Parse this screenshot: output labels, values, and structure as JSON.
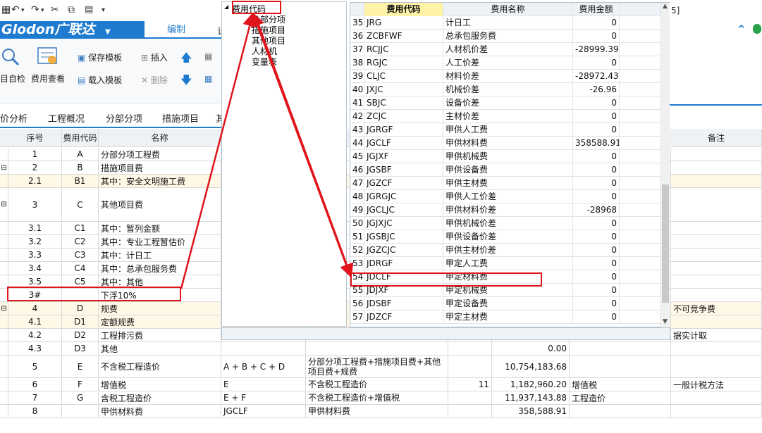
{
  "toolbar": {
    "undo": "↶",
    "redo": "↷",
    "cut": "✂",
    "copy": "⧉",
    "paste": "📋",
    "more": "▾"
  },
  "brand": {
    "name": "Glodon广联达",
    "arrow": "▼"
  },
  "tabs": {
    "edit": "编制",
    "partial": "计"
  },
  "ribbon": {
    "check": "目自检",
    "fee_view": "费用查看",
    "save_template": "保存模板",
    "load_template": "载入模板",
    "insert": "插入",
    "delete": "删除"
  },
  "nav": [
    "价分析",
    "工程概况",
    "分部分项",
    "措施项目",
    "其"
  ],
  "right": {
    "title_fragment": "5]",
    "collapse": "^",
    "remark_header": "备注"
  },
  "grid": {
    "headers": {
      "seq": "序号",
      "code": "费用代码",
      "name": "名称"
    },
    "rows": [
      {
        "seq": "1",
        "code": "A",
        "name": "分部分项工程费",
        "expr": "",
        "base": "",
        "rate": "",
        "amount": "",
        "type": "",
        "remark": "",
        "tree": "",
        "y": false
      },
      {
        "seq": "2",
        "code": "B",
        "name": "措施项目费",
        "expr": "",
        "base": "",
        "rate": "",
        "amount": "",
        "type": "",
        "remark": "",
        "tree": "⊟",
        "y": false
      },
      {
        "seq": "2.1",
        "code": "B1",
        "name": "其中：安全文明施工费",
        "expr": "",
        "base": "",
        "rate": "",
        "amount": "",
        "type": "",
        "remark": "",
        "tree": "",
        "y": true
      },
      {
        "seq": "3",
        "code": "C",
        "name": "其他项目费",
        "expr": "",
        "base": "",
        "rate": "",
        "amount": "",
        "type": "",
        "remark": "",
        "tree": "⊟",
        "y": false
      },
      {
        "seq": "3.1",
        "code": "C1",
        "name": "其中：暂列金额",
        "expr": "",
        "base": "",
        "rate": "",
        "amount": "",
        "type": "",
        "remark": "",
        "tree": "",
        "y": false
      },
      {
        "seq": "3.2",
        "code": "C2",
        "name": "其中：专业工程暂估价",
        "expr": "",
        "base": "",
        "rate": "",
        "amount": "",
        "type": "",
        "remark": "",
        "tree": "",
        "y": false
      },
      {
        "seq": "3.3",
        "code": "C3",
        "name": "其中：计日工",
        "expr": "",
        "base": "",
        "rate": "",
        "amount": "",
        "type": "",
        "remark": "",
        "tree": "",
        "y": false
      },
      {
        "seq": "3.4",
        "code": "C4",
        "name": "其中：总承包服务费",
        "expr": "",
        "base": "",
        "rate": "",
        "amount": "",
        "type": "",
        "remark": "",
        "tree": "",
        "y": false
      },
      {
        "seq": "3.5",
        "code": "C5",
        "name": "其中：其他",
        "expr": "",
        "base": "",
        "rate": "",
        "amount": "",
        "type": "",
        "remark": "",
        "tree": "",
        "y": false
      },
      {
        "seq": "3#",
        "code": "",
        "name": "下浮10%",
        "expr": "",
        "base": "",
        "rate": "",
        "amount": "",
        "type": "",
        "remark": "",
        "tree": "",
        "y": false
      },
      {
        "seq": "4",
        "code": "D",
        "name": "规费",
        "expr": "",
        "base": "",
        "rate": "",
        "amount": "",
        "type": "",
        "remark": "不可竞争费",
        "tree": "⊟",
        "y": true
      },
      {
        "seq": "4.1",
        "code": "D1",
        "name": "定额规费",
        "expr": "",
        "base": "",
        "rate": "",
        "amount": "",
        "type": "",
        "remark": "",
        "tree": "",
        "y": true
      },
      {
        "seq": "4.2",
        "code": "D2",
        "name": "工程排污费",
        "expr": "",
        "base": "",
        "rate": "",
        "amount": "",
        "type": "",
        "remark": "据实计取",
        "tree": "",
        "y": false
      },
      {
        "seq": "4.3",
        "code": "D3",
        "name": "其他",
        "expr": "",
        "base": "",
        "rate": "",
        "amount": "0.00",
        "type": "",
        "remark": "",
        "tree": "",
        "y": false
      },
      {
        "seq": "5",
        "code": "E",
        "name": "不含税工程造价",
        "expr": "A + B + C + D",
        "base": "分部分项工程费+措施项目费+其他项目费+规费",
        "rate": "",
        "amount": "10,754,183.68",
        "type": "",
        "remark": "",
        "tree": "",
        "y": false
      },
      {
        "seq": "6",
        "code": "F",
        "name": "增值税",
        "expr": "E",
        "base": "不含税工程造价",
        "rate": "11",
        "amount": "1,182,960.20",
        "type": "增值税",
        "remark": "一般计税方法",
        "tree": "",
        "y": false
      },
      {
        "seq": "7",
        "code": "G",
        "name": "含税工程造价",
        "expr": "E + F",
        "base": "不含税工程造价+增值税",
        "rate": "",
        "amount": "11,937,143.88",
        "type": "工程造价",
        "remark": "",
        "tree": "",
        "y": false
      },
      {
        "seq": "8",
        "code": "",
        "name": "甲供材料费",
        "expr": "JGCLF",
        "base": "甲供材料费",
        "rate": "",
        "amount": "358,588.91",
        "type": "",
        "remark": "",
        "tree": "",
        "y": false
      }
    ]
  },
  "tree_popup": {
    "root": "费用代码",
    "items": [
      "分部分项",
      "措施项目",
      "其他项目",
      "人材机",
      "变量表"
    ]
  },
  "code_table": {
    "headers": {
      "code": "费用代码",
      "name": "费用名称",
      "amount": "费用金额"
    },
    "rows": [
      {
        "no": "35",
        "code": "JRG",
        "name": "计日工",
        "amount": "0"
      },
      {
        "no": "36",
        "code": "ZCBFWF",
        "name": "总承包服务费",
        "amount": "0"
      },
      {
        "no": "37",
        "code": "RCJJC",
        "name": "人材机价差",
        "amount": "-28999.39"
      },
      {
        "no": "38",
        "code": "RGJC",
        "name": "人工价差",
        "amount": "0"
      },
      {
        "no": "39",
        "code": "CLJC",
        "name": "材料价差",
        "amount": "-28972.43"
      },
      {
        "no": "40",
        "code": "JXJC",
        "name": "机械价差",
        "amount": "-26.96"
      },
      {
        "no": "41",
        "code": "SBJC",
        "name": "设备价差",
        "amount": "0"
      },
      {
        "no": "42",
        "code": "ZCJC",
        "name": "主材价差",
        "amount": "0"
      },
      {
        "no": "43",
        "code": "JGRGF",
        "name": "甲供人工费",
        "amount": "0"
      },
      {
        "no": "44",
        "code": "JGCLF",
        "name": "甲供材料费",
        "amount": "358588.91"
      },
      {
        "no": "45",
        "code": "JGJXF",
        "name": "甲供机械费",
        "amount": "0"
      },
      {
        "no": "46",
        "code": "JGSBF",
        "name": "甲供设备费",
        "amount": "0"
      },
      {
        "no": "47",
        "code": "JGZCF",
        "name": "甲供主材费",
        "amount": "0"
      },
      {
        "no": "48",
        "code": "JGRGJC",
        "name": "甲供人工价差",
        "amount": "0"
      },
      {
        "no": "49",
        "code": "JGCLJC",
        "name": "甲供材料价差",
        "amount": "-28968"
      },
      {
        "no": "50",
        "code": "JGJXJC",
        "name": "甲供机械价差",
        "amount": "0"
      },
      {
        "no": "51",
        "code": "JGSBJC",
        "name": "甲供设备价差",
        "amount": "0"
      },
      {
        "no": "52",
        "code": "JGZCJC",
        "name": "甲供主材价差",
        "amount": "0"
      },
      {
        "no": "53",
        "code": "JDRGF",
        "name": "甲定人工费",
        "amount": "0"
      },
      {
        "no": "54",
        "code": "JDCLF",
        "name": "甲定材料费",
        "amount": "0"
      },
      {
        "no": "55",
        "code": "JDJXF",
        "name": "甲定机械费",
        "amount": "0"
      },
      {
        "no": "56",
        "code": "JDSBF",
        "name": "甲定设备费",
        "amount": "0"
      },
      {
        "no": "57",
        "code": "JDZCF",
        "name": "甲定主材费",
        "amount": "0"
      }
    ]
  },
  "colors": {
    "brand": "#1f7bd0",
    "annotation": "#e0141b",
    "highlight_header": "#fff3a8",
    "yellow_row": "#fff8e6"
  }
}
